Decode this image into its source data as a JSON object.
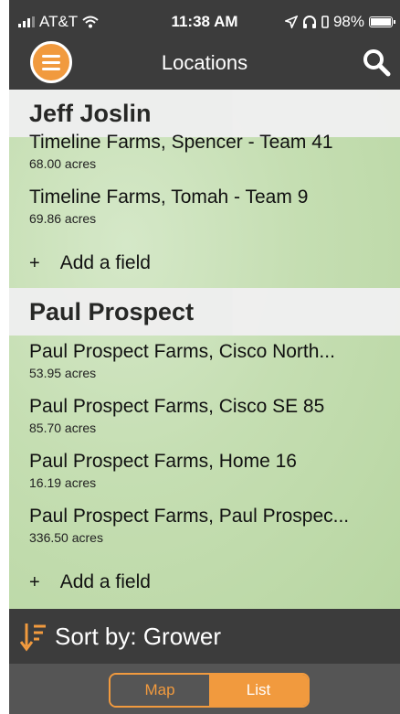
{
  "status_bar": {
    "carrier": "AT&T",
    "time": "11:38 AM",
    "battery": "98%",
    "battery_level": 0.98
  },
  "nav": {
    "title": "Locations",
    "menu_icon": "hamburger-menu-icon",
    "search_icon": "search-icon"
  },
  "groups": [
    {
      "grower": "Jeff Joslin",
      "fields": [
        {
          "name": "Timeline Farms, Spencer - Team 41",
          "acres": "68.00 acres"
        },
        {
          "name": "Timeline Farms, Tomah - Team 9",
          "acres": "69.86 acres"
        }
      ],
      "add_label": "Add a field"
    },
    {
      "grower": "Paul Prospect",
      "fields": [
        {
          "name": "Paul Prospect Farms, Cisco North...",
          "acres": "53.95 acres"
        },
        {
          "name": "Paul Prospect Farms, Cisco SE 85",
          "acres": "85.70 acres"
        },
        {
          "name": "Paul Prospect Farms, Home 16",
          "acres": "16.19 acres"
        },
        {
          "name": "Paul Prospect Farms, Paul Prospec...",
          "acres": "336.50 acres"
        }
      ],
      "add_label": "Add a field"
    }
  ],
  "add_symbol": "+",
  "sort": {
    "label": "Sort by: Grower"
  },
  "view_toggle": {
    "map": "Map",
    "list": "List",
    "selected": "List"
  },
  "colors": {
    "accent": "#f19a3e",
    "bar": "#3c3c3c"
  }
}
